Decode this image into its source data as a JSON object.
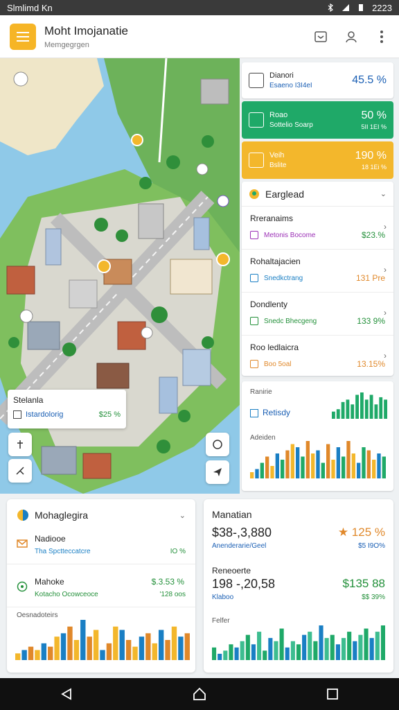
{
  "status_bar": {
    "left_text": "Slmlimd Kn",
    "time": "2223",
    "icons": [
      "bluetooth-icon",
      "signal-icon",
      "battery-icon"
    ]
  },
  "app_bar": {
    "title": "Moht Imojanatie",
    "subtitle": "Memgegrgen",
    "actions": [
      "inbox-icon",
      "profile-icon",
      "more-icon"
    ]
  },
  "map": {
    "info_card": {
      "title": "Stelanla",
      "subtitle": "Istardolorig",
      "value": "$25 %"
    },
    "controls": [
      "locate-icon",
      "compass-icon",
      "layers-icon",
      "directions-icon"
    ]
  },
  "kpis": [
    {
      "title": "Dianori",
      "subtitle": "Esaeno I3I4eI",
      "value": "45.5 %",
      "style": "white"
    },
    {
      "title": "Roao",
      "subtitle": "Sottelio Soarp",
      "value": "50 %",
      "value_sub": "5II 1EI %",
      "style": "green"
    },
    {
      "title": "Veih",
      "subtitle": "Bslite",
      "value": "190 %",
      "value_sub": "18 1Ei %",
      "style": "yellow"
    }
  ],
  "list_panel": {
    "title": "Earglead",
    "items": [
      {
        "title": "Rreranaims",
        "subtitle": "Metonis Bocome",
        "value": "$23.%",
        "sub_color": "#9b30b6",
        "val_color": "#23903a"
      },
      {
        "title": "Rohaltajacien",
        "subtitle": "Snedkctrang",
        "value": "131 Pre",
        "sub_color": "#1a7fc4",
        "val_color": "#e0882a"
      },
      {
        "title": "Dondlenty",
        "subtitle": "Snedc Bhecgeng",
        "value": "133 9%",
        "sub_color": "#23903a",
        "val_color": "#23903a"
      },
      {
        "title": "Roo ledlaicra",
        "subtitle": "Boo 5oal",
        "value": "13.15%",
        "sub_color": "#e0882a",
        "val_color": "#e0882a"
      }
    ]
  },
  "chart_panel": {
    "label_top": "Ranirie",
    "legend": "Retisdy",
    "label_bottom": "Adeiden"
  },
  "card_left": {
    "title": "Mohaglegira",
    "rows": [
      {
        "title": "Nadiooe",
        "subtitle": "Tha Spctteccatcre",
        "value": "IO %",
        "tv": ""
      },
      {
        "title": "Mahoke",
        "subtitle": "Kotacho Ocowceoce",
        "value": "'128 oos",
        "tv": "$.3.53 %"
      }
    ],
    "chart_label": "Oesnadoteirs"
  },
  "card_right": {
    "title": "Manatian",
    "big1": "$38-,3,880",
    "big1_sub": "Anenderarie/Geel",
    "rate1": "125 %",
    "rate1_sub": "$5 I9O%",
    "label2": "Reneoerte",
    "big2": "198 -,20,58",
    "big2_sub": "Klaboo",
    "rate2": "$135 88",
    "rate2_sub": "$$ 39%",
    "chart_label": "Felfer"
  },
  "colors": {
    "accent_yellow": "#f3b72c",
    "accent_green": "#1fa968",
    "accent_blue": "#1a5fb4",
    "orange": "#e0882a"
  },
  "chart_data": [
    {
      "type": "bar",
      "name": "list-panel-top",
      "values": [
        3,
        4,
        7,
        8,
        6,
        10,
        11,
        8,
        10,
        6,
        9,
        8
      ]
    },
    {
      "type": "bar",
      "name": "list-panel-bottom",
      "values": [
        2,
        3,
        5,
        7,
        4,
        8,
        6,
        9,
        11,
        10,
        7,
        12,
        8,
        9,
        5,
        11,
        6,
        10,
        7,
        12,
        8,
        5,
        10,
        9,
        6,
        8,
        7
      ]
    },
    {
      "type": "bar",
      "name": "card-left-chart",
      "values": [
        2,
        3,
        4,
        3,
        5,
        4,
        7,
        8,
        10,
        6,
        12,
        7,
        9,
        3,
        5,
        10,
        9,
        6,
        4,
        7,
        8,
        5,
        9,
        6,
        10,
        7,
        8
      ]
    },
    {
      "type": "bar",
      "name": "card-right-chart",
      "values": [
        4,
        2,
        3,
        5,
        4,
        6,
        8,
        5,
        9,
        3,
        7,
        6,
        10,
        4,
        6,
        5,
        8,
        9,
        6,
        11,
        7,
        8,
        5,
        7,
        9,
        6,
        8,
        10,
        7,
        9,
        11
      ]
    }
  ]
}
